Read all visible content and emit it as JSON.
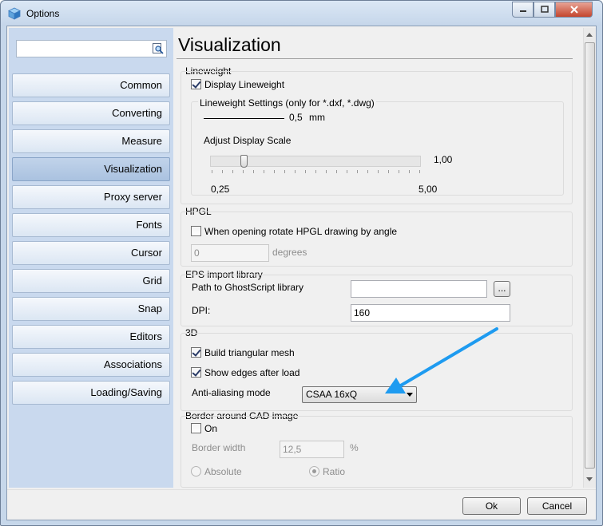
{
  "window": {
    "title": "Options"
  },
  "search": {
    "value": ""
  },
  "sidebar": {
    "items": [
      {
        "label": "Common"
      },
      {
        "label": "Converting"
      },
      {
        "label": "Measure"
      },
      {
        "label": "Visualization"
      },
      {
        "label": "Proxy server"
      },
      {
        "label": "Fonts"
      },
      {
        "label": "Cursor"
      },
      {
        "label": "Grid"
      },
      {
        "label": "Snap"
      },
      {
        "label": "Editors"
      },
      {
        "label": "Associations"
      },
      {
        "label": "Loading/Saving"
      }
    ],
    "active_index": 3
  },
  "page": {
    "title": "Visualization"
  },
  "lineweight": {
    "group_label": "Lineweight",
    "display_label": "Display Lineweight",
    "display_checked": true,
    "settings_label": "Lineweight Settings (only for *.dxf, *.dwg)",
    "value": "0,5",
    "unit": "mm",
    "scale_label": "Adjust Display Scale",
    "scale_value": "1,00",
    "scale_min": "0,25",
    "scale_max": "5,00",
    "scale_fraction": 0.16
  },
  "hpgl": {
    "group_label": "HPGL",
    "rotate_label": "When opening rotate HPGL drawing by angle",
    "rotate_checked": false,
    "angle_value": "0",
    "angle_unit": "degrees"
  },
  "eps": {
    "group_label": "EPS import library",
    "path_label": "Path to GhostScript library",
    "path_value": "",
    "browse_label": "...",
    "dpi_label": "DPI:",
    "dpi_value": "160"
  },
  "three_d": {
    "group_label": "3D",
    "mesh_label": "Build triangular mesh",
    "mesh_checked": true,
    "edges_label": "Show edges after load",
    "edges_checked": true,
    "aa_label": "Anti-aliasing mode",
    "aa_value": "CSAA 16xQ"
  },
  "border": {
    "group_label": "Border around CAD image",
    "on_label": "On",
    "on_checked": false,
    "width_label": "Border width",
    "width_value": "12,5",
    "width_unit": "%",
    "absolute_label": "Absolute",
    "ratio_label": "Ratio"
  },
  "footer": {
    "ok_label": "Ok",
    "cancel_label": "Cancel"
  },
  "colors": {
    "arrow": "#1e9bf0",
    "sidebar": "#c9d9ee"
  }
}
